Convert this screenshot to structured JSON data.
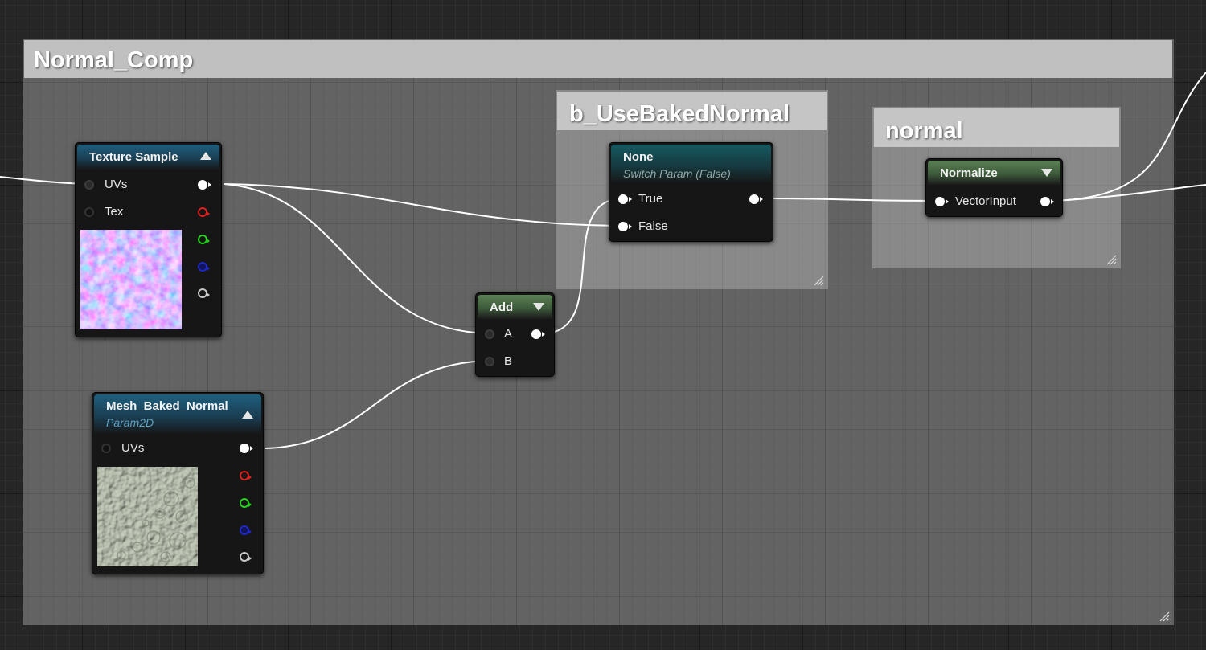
{
  "graph": {
    "outer_comment": {
      "title": "Normal_Comp"
    },
    "switch_comment": {
      "title": "b_UseBakedNormal"
    },
    "normal_comment": {
      "title": "normal"
    }
  },
  "nodes": {
    "texture_sample": {
      "title": "Texture Sample",
      "inputs": [
        "UVs",
        "Tex"
      ],
      "outputs": [
        "rgb",
        "r",
        "g",
        "b",
        "a"
      ],
      "output_colors": [
        "#ffffff",
        "#e0201e",
        "#22d41c",
        "#2028c8",
        "#c8c8c8"
      ],
      "preview_icon": "normal-map-thumbnail"
    },
    "mesh_baked_normal": {
      "title": "Mesh_Baked_Normal",
      "subtitle": "Param2D",
      "inputs": [
        "UVs"
      ],
      "outputs": [
        "rgb",
        "r",
        "g",
        "b",
        "a"
      ],
      "output_colors": [
        "#ffffff",
        "#e0201e",
        "#22d41c",
        "#2028c8",
        "#c8c8c8"
      ],
      "preview_icon": "baked-normal-thumbnail"
    },
    "add": {
      "title": "Add",
      "inputs": [
        "A",
        "B"
      ]
    },
    "switch_param": {
      "title": "None",
      "subtitle": "Switch Param (False)",
      "inputs": [
        "True",
        "False"
      ]
    },
    "normalize": {
      "title": "Normalize",
      "inputs": [
        "VectorInput"
      ]
    }
  },
  "colors": {
    "canvas": "#262626",
    "wire": "#ffffff",
    "pin_red": "#e0201e",
    "pin_green": "#22d41c",
    "pin_blue": "#2028c8",
    "pin_alpha": "#c8c8c8"
  }
}
